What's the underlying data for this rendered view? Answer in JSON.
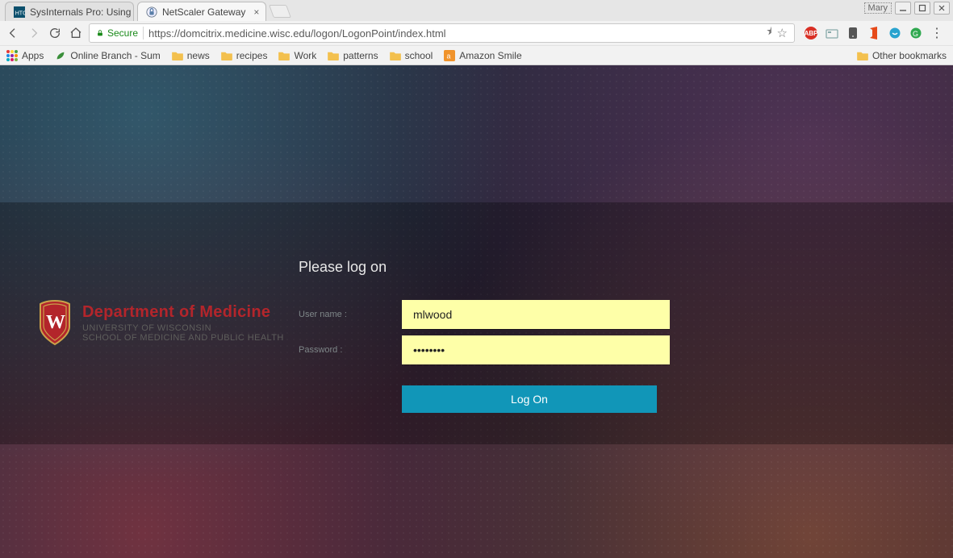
{
  "window": {
    "user_label": "Mary",
    "min_tip": "Minimize",
    "max_tip": "Maximize",
    "close_tip": "Close"
  },
  "tabs": [
    {
      "title": "SysInternals Pro: Using A",
      "active": false
    },
    {
      "title": "NetScaler Gateway",
      "active": true
    }
  ],
  "omnibox": {
    "secure_label": "Secure",
    "url": "https://domcitrix.medicine.wisc.edu/logon/LogonPoint/index.html"
  },
  "ext": {
    "abp_label": "ABP"
  },
  "bookmarks": {
    "apps": "Apps",
    "items": [
      "Online Branch - Sum",
      "news",
      "recipes",
      "Work",
      "patterns",
      "school",
      "Amazon Smile"
    ],
    "other": "Other bookmarks"
  },
  "brand": {
    "line1": "Department of Medicine",
    "line2": "UNIVERSITY OF WISCONSIN",
    "line3": "SCHOOL OF MEDICINE AND PUBLIC HEALTH"
  },
  "form": {
    "title": "Please log on",
    "username_label": "User name :",
    "password_label": "Password :",
    "username_value": "mlwood",
    "password_value": "••••••••",
    "submit_label": "Log On"
  }
}
